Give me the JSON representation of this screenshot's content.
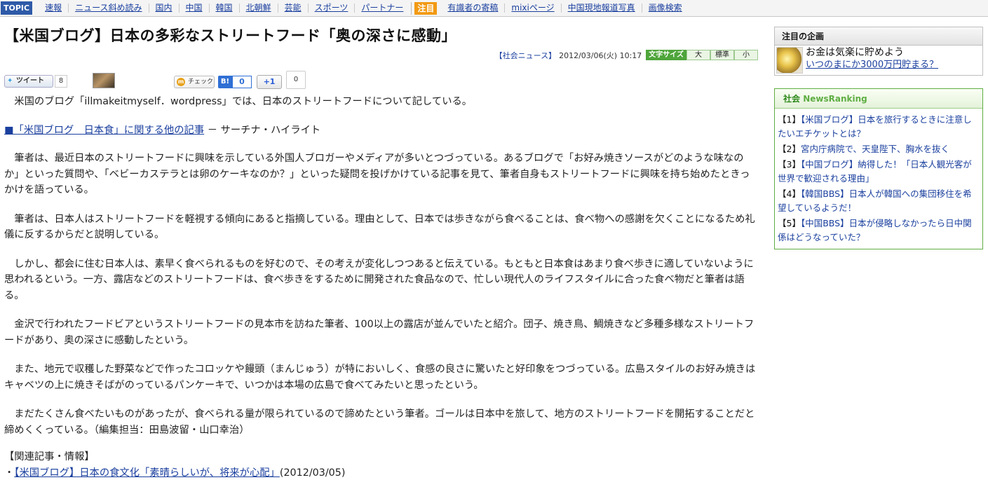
{
  "topnav": {
    "topic_label": "TOPIC",
    "links": [
      "速報",
      "ニュース斜め読み",
      "国内",
      "中国",
      "韓国",
      "北朝鮮",
      "芸能",
      "スポーツ",
      "パートナー"
    ],
    "attention_label": "注目",
    "attention_links": [
      "有識者の寄稿",
      "mixiページ",
      "中国現地報道写真",
      "画像検索"
    ]
  },
  "article": {
    "title": "【米国ブログ】日本の多彩なストリートフード「奥の深さに感動」",
    "category": "【社会ニュース】",
    "datetime": "2012/03/06(火) 10:17",
    "font_size_label": "文字サイズ",
    "font_size_options": [
      "大",
      "標準",
      "小"
    ],
    "social": {
      "tweet_label": "ツイート",
      "tweet_count": "8",
      "check_label": "チェック",
      "hatena_label": "B!",
      "hatena_count": "0",
      "plusone_label": "+1",
      "plusone_count": "0"
    },
    "lead": "米国のブログ「illmakeitmyself．wordpress」では、日本のストリートフードについて記している。",
    "related_inline_link": "■「米国ブログ　日本食」に関する他の記事",
    "related_inline_tail": " － サーチナ・ハイライト",
    "paragraphs": [
      "筆者は、最近日本のストリートフードに興味を示している外国人ブロガーやメディアが多いとつづっている。あるブログで「お好み焼きソースがどのような味なのか」といった質問や、「ベビーカステラとは卵のケーキなのか？」といった疑問を投げかけている記事を見て、筆者自身もストリートフードに興味を持ち始めたときっかけを語っている。",
      "筆者は、日本人はストリートフードを軽視する傾向にあると指摘している。理由として、日本では歩きながら食べることは、食べ物への感謝を欠くことになるため礼儀に反するからだと説明している。",
      "しかし、都会に住む日本人は、素早く食べられるものを好むので、その考えが変化しつつあると伝えている。もともと日本食はあまり食べ歩きに適していないように思われるという。一方、露店などのストリートフードは、食べ歩きをするために開発された食品なので、忙しい現代人のライフスタイルに合った食べ物だと筆者は語る。",
      "金沢で行われたフードビアというストリートフードの見本市を訪ねた筆者、100以上の露店が並んでいたと紹介。団子、焼き鳥、鯛焼きなど多種多様なストリートフードがあり、奥の深さに感動したという。",
      "また、地元で収穫した野菜などで作ったコロッケや饅頭（まんじゅう）が特においしく、食感の良さに驚いたと好印象をつづっている。広島スタイルのお好み焼きはキャベツの上に焼きそばがのっているパンケーキで、いつかは本場の広島で食べてみたいと思ったという。",
      "まだたくさん食べたいものがあったが、食べられる量が限られているので諦めたという筆者。ゴールは日本中を旅して、地方のストリートフードを開拓することだと締めくくっている。（編集担当：田島波留・山口幸治）"
    ],
    "related_heading": "【関連記事・情報】",
    "related_bullet": "・",
    "related_link": "【米国ブログ】日本の食文化「素晴らしいが、将来が心配」",
    "related_date": "(2012/03/05)"
  },
  "sidebar": {
    "feature_heading": "注目の企画",
    "feature_title": "お金は気楽に貯めよう",
    "feature_link": "いつのまにか3000万円貯まる？",
    "ranking_category": "社会",
    "ranking_label": "NewsRanking",
    "ranking": [
      {
        "num": "【1】",
        "text": "【米国ブログ】日本を旅行するときに注意したいエチケットとは？"
      },
      {
        "num": "【2】",
        "text": "宮内庁病院で、天皇陛下、胸水を抜く"
      },
      {
        "num": "【3】",
        "text": "【中国ブログ】納得した！「日本人観光客が世界で歓迎される理由」"
      },
      {
        "num": "【4】",
        "text": "【韓国BBS】日本人が韓国への集団移住を希望しているようだ！"
      },
      {
        "num": "【5】",
        "text": "【中国BBS】日本が侵略しなかったら日中関係はどうなっていた？"
      }
    ]
  }
}
